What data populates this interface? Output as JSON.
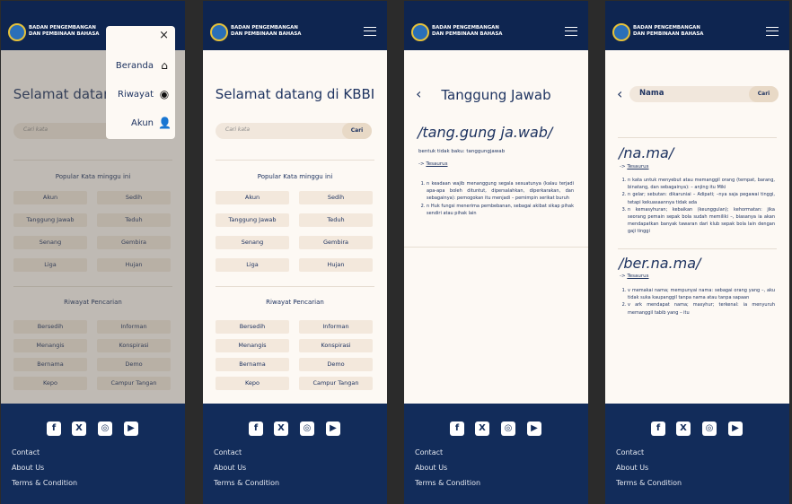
{
  "colors": {
    "navy": "#0e2550",
    "footer": "#122c5a",
    "cream": "#fdf9f4",
    "chip": "#f3e8dc"
  },
  "brand": {
    "line1": "BADAN PENGEMBANGAN",
    "line2": "DAN PEMBINAAN BAHASA"
  },
  "footer": {
    "social": [
      {
        "icon": "facebook-icon",
        "glyph": "f"
      },
      {
        "icon": "x-icon",
        "glyph": "X"
      },
      {
        "icon": "instagram-icon",
        "glyph": "◎"
      },
      {
        "icon": "youtube-icon",
        "glyph": "▶"
      }
    ],
    "links": [
      "Contact",
      "About Us",
      "Terms & Condition"
    ]
  },
  "home": {
    "title": "Selamat datang di KBBI",
    "search_placeholder": "Cari kata",
    "search_button": "Cari",
    "popular_heading": "Popular Kata minggu ini",
    "popular": [
      "Akun",
      "Sedih",
      "Tanggung Jawab",
      "Teduh",
      "Senang",
      "Gembira",
      "Liga",
      "Hujan"
    ],
    "history_heading": "Riwayat Pencarian",
    "history": [
      "Bersedih",
      "Informan",
      "Menangis",
      "Konspirasi",
      "Bernama",
      "Demo",
      "Kepo",
      "Campur Tangan"
    ]
  },
  "menu": {
    "close": "×",
    "items": [
      {
        "label": "Beranda",
        "icon": "home-icon",
        "glyph": "⌂"
      },
      {
        "label": "Riwayat",
        "icon": "history-icon",
        "glyph": "◉"
      },
      {
        "label": "Akun",
        "icon": "user-icon",
        "glyph": "👤"
      }
    ]
  },
  "detail": {
    "title": "Tanggung Jawab",
    "phonetic": "/tang.gung ja.wab/",
    "nonstandard": "bentuk tidak baku: tanggungjawab",
    "thesaurus": "Tesaurus",
    "arrow": "->",
    "definitions": [
      "n keadaan wajib menanggung segala sesuatunya (kalau terjadi apa-apa boleh dituntut, dipersalahkan, diperkarakan, dan sebagainya): pemogokan itu menjadi – pemimpin serikat buruh",
      "n Huk fungsi menerima pembebanan, sebagai akibat sikap pihak sendiri atau pihak lain"
    ]
  },
  "search_result": {
    "query": "Nama",
    "button": "Cari",
    "entries": [
      {
        "phonetic": "/na.ma/",
        "thesaurus": "Tesaurus",
        "definitions": [
          "n kata untuk menyebut atau memanggil orang (tempat, barang, binatang, dan sebagainya): – anjing itu Miki",
          "n gelar; sebutan: dikaruniai – Adipati; –nya saja pegawai tinggi, tetapi kekuasaannya tidak ada",
          "n kemasyhuran; kebaikan (keunggulan); kehormatan: jika seorang pemain sepak bola sudah memiliki –, biasanya ia akan mendapatkan banyak tawaran dari klub sepak bola lain dengan gaji tinggi"
        ]
      },
      {
        "phonetic": "/ber.na.ma/",
        "thesaurus": "Tesaurus",
        "definitions": [
          "v memakai nama; mempunyai nama: sebagai orang yang –, aku tidak suka kaupanggil tanpa nama atau tanpa sapaan",
          "v ark mendapat nama; masyhur; terkenal: ia menyuruh memanggil tabib yang – itu"
        ]
      }
    ]
  }
}
